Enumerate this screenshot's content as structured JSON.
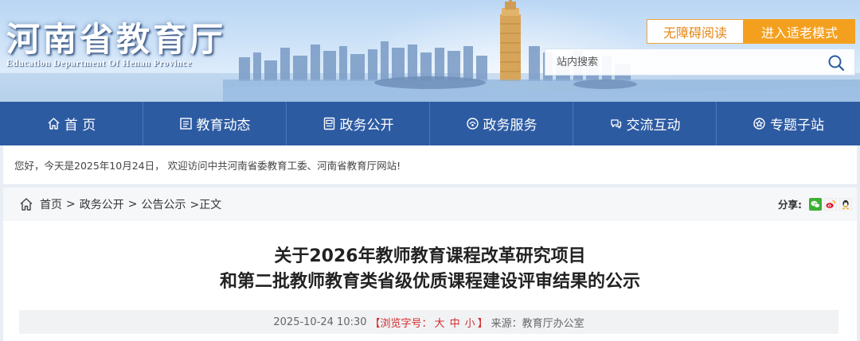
{
  "site": {
    "title_cn": "河南省教育厅",
    "title_en": "Education Department Of Henan Province"
  },
  "header": {
    "accessible_btn": "无障碍阅读",
    "elder_mode_btn": "进入适老模式",
    "search_placeholder": "站内搜索",
    "search_icon": "search-icon"
  },
  "nav": {
    "items": [
      {
        "label": "首 页",
        "icon": "home-icon"
      },
      {
        "label": "教育动态",
        "icon": "news-icon"
      },
      {
        "label": "政务公开",
        "icon": "document-icon"
      },
      {
        "label": "政务服务",
        "icon": "service-icon"
      },
      {
        "label": "交流互动",
        "icon": "interaction-icon"
      },
      {
        "label": "专题子站",
        "icon": "topic-icon"
      }
    ]
  },
  "welcome": {
    "text": "您好，今天是2025年10月24日， 欢迎访问中共河南省委教育工委、河南省教育厅网站!"
  },
  "breadcrumb": {
    "items": [
      "首页",
      "政务公开",
      "公告公示"
    ],
    "separator": ">",
    "current": ">正文"
  },
  "share": {
    "label": "分享:",
    "targets": [
      "wechat-icon",
      "weibo-icon",
      "qq-icon"
    ]
  },
  "article": {
    "title_line1": "关于2026年教师教育课程改革研究项目",
    "title_line2": "和第二批教师教育类省级优质课程建设评审结果的公示",
    "datetime": "2025-10-24 10:30",
    "font_size_prefix": "【浏览字号：",
    "font_size_large": "大",
    "font_size_medium": "中",
    "font_size_small": "小",
    "font_size_suffix": "】",
    "source": "来源：教育厅办公室"
  },
  "colors": {
    "nav_bg": "#2d5ba2",
    "accent_orange": "#f4a01f",
    "size_control_red": "#d22b2b"
  }
}
